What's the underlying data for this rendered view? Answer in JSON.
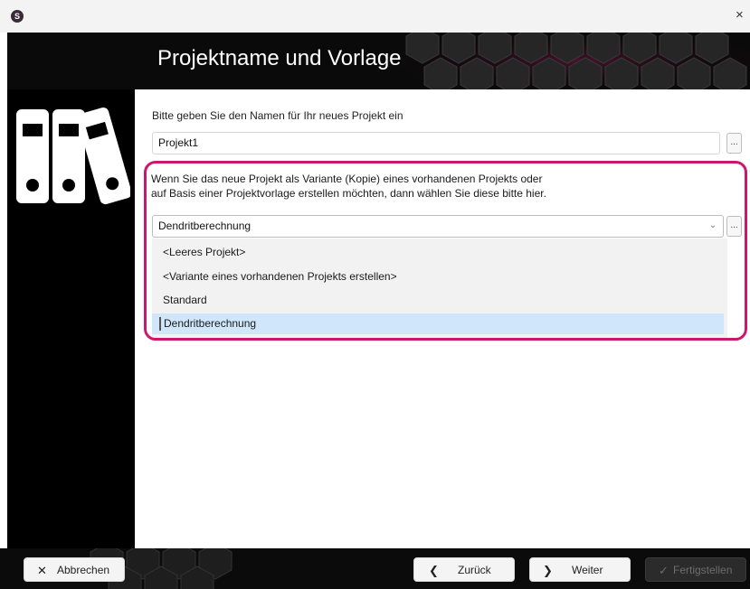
{
  "window": {
    "close_glyph": "×",
    "app_icon_letter": "S"
  },
  "header": {
    "title": "Projektname und Vorlage"
  },
  "project": {
    "name_label": "Bitte geben Sie den Namen für Ihr neues Projekt ein",
    "name_value": "Projekt1",
    "browse_label": "..."
  },
  "template": {
    "description_line1": "Wenn Sie das neue Projekt als Variante (Kopie) eines vorhandenen Projekts oder",
    "description_line2": "auf Basis einer Projektvorlage erstellen möchten, dann wählen Sie diese bitte hier.",
    "selected": "Dendritberechnung",
    "options": [
      "<Leeres Projekt>",
      "<Variante eines vorhandenen Projekts erstellen>",
      "Standard",
      "Dendritberechnung"
    ],
    "browse_label": "..."
  },
  "footer": {
    "cancel_label": "Abbrechen",
    "back_label": "Zurück",
    "next_label": "Weiter",
    "finish_label": "Fertigstellen"
  },
  "icons": {
    "app": "app-logo-icon",
    "close": "close-icon",
    "binders": "binders-icon",
    "chevron": "chevron-down-icon",
    "cancel": "x-icon",
    "back": "chevron-left-icon",
    "next": "chevron-right-icon",
    "finish": "check-icon"
  },
  "colors": {
    "highlight": "#cc1670",
    "selected_item": "#cfe6fb",
    "header_bg": "#0a0a0a"
  }
}
